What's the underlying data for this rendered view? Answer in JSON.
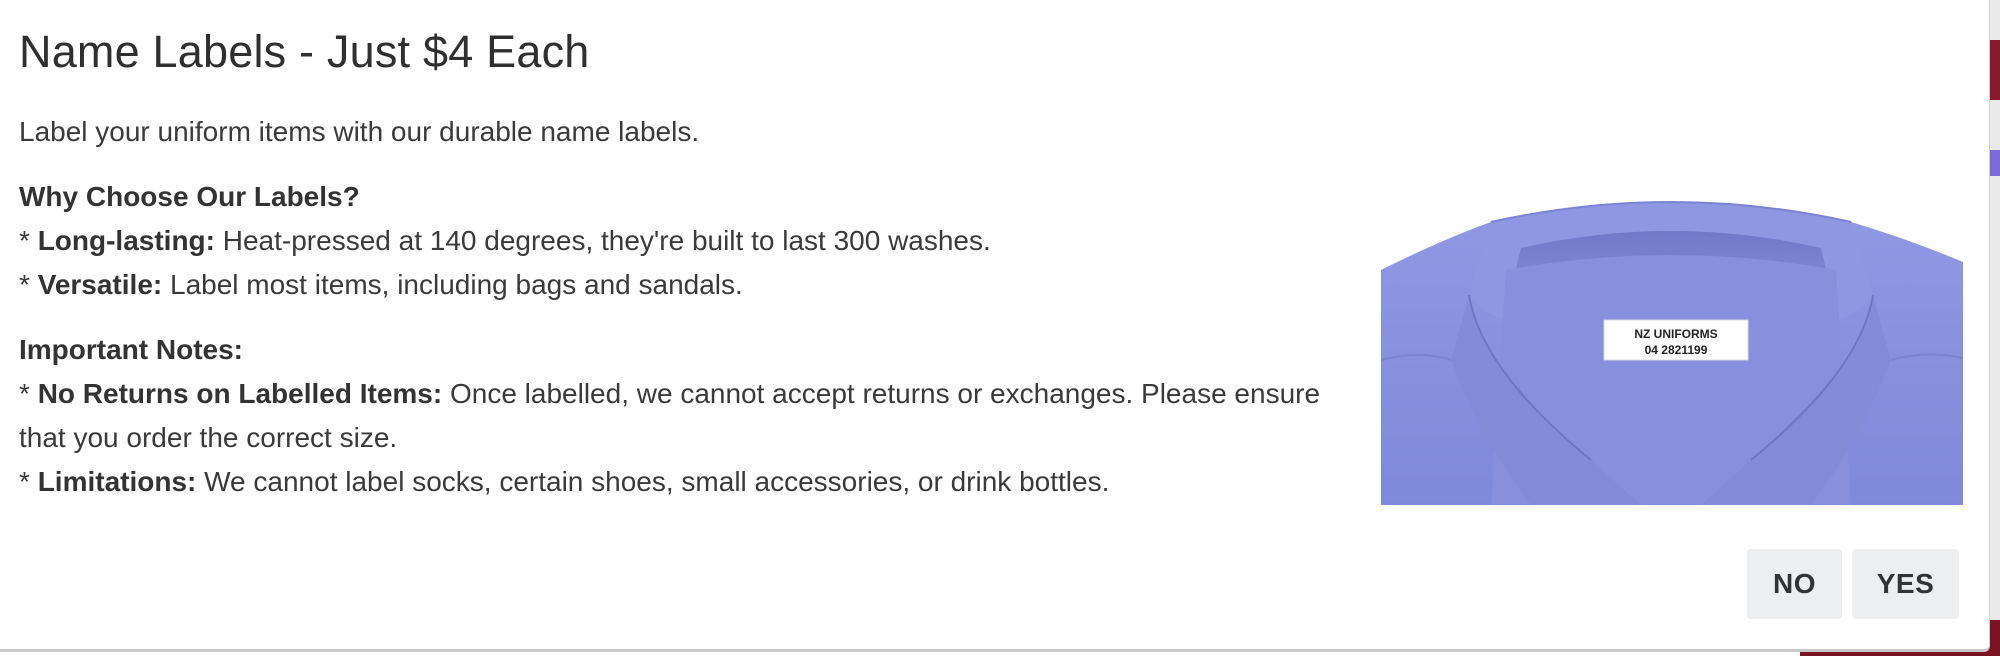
{
  "dialog": {
    "title": "Name Labels - Just $4 Each",
    "intro": "Label your uniform items with our durable name labels.",
    "why_heading": "Why Choose Our Labels?",
    "why_items": [
      {
        "bold": "Long-lasting:",
        "text": " Heat-pressed at 140 degrees, they're built to last 300 washes."
      },
      {
        "bold": "Versatile:",
        "text": " Label most items, including bags and sandals."
      }
    ],
    "notes_heading": "Important Notes:",
    "notes_items": [
      {
        "bold": "No Returns on Labelled Items:",
        "text": " Once labelled, we cannot accept returns or exchanges. Please ensure that you order the correct size."
      },
      {
        "bold": "Limitations:",
        "text": " We cannot label socks, certain shoes, small accessories, or drink bottles."
      }
    ],
    "bullet_marker": "* ",
    "image": {
      "label_line1": "NZ UNIFORMS",
      "label_line2": "04 2821199",
      "shirt_color": "#8a93e0"
    },
    "buttons": {
      "no_label": "NO",
      "yes_label": "YES"
    }
  }
}
